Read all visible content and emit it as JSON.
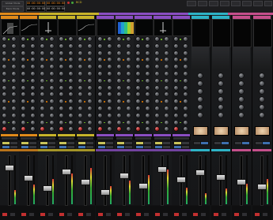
{
  "topbar": {
    "label_a": "Global Mode",
    "label_b": "Bank Mode",
    "timecode_primary": "00:00:00:00",
    "timecode_secondary": "00:00:00:00",
    "timecode_primary_b": "00:00:00:00",
    "timecode_secondary_b": "00:00:00:00",
    "mode_label": "BCD"
  },
  "colors": {
    "orange": "#e08a1a",
    "yellow": "#c8b42a",
    "purple": "#8a4ec2",
    "cyan": "#2eb3c6",
    "pink": "#c54f8b",
    "green": "#47a63a",
    "red": "#c23030",
    "fader_cap": "#d0d0d0"
  },
  "channels": [
    {
      "color": "#e08a1a",
      "display": "compressor"
    },
    {
      "color": "#e08a1a",
      "display": "eq-curve"
    },
    {
      "color": "#c8b42a",
      "display": "gate"
    },
    {
      "color": "#c8b42a",
      "display": "blank"
    },
    {
      "color": "#c8b42a",
      "display": "eq-curve"
    },
    {
      "color": "#8a4ec2",
      "display": "blank"
    },
    {
      "color": "#8a4ec2",
      "display": "spectrum"
    },
    {
      "color": "#8a4ec2",
      "display": "blank"
    },
    {
      "color": "#8a4ec2",
      "display": "gate"
    },
    {
      "color": "#8a4ec2",
      "display": "blank"
    }
  ],
  "fx_returns": [
    {
      "color": "#2eb3c6"
    },
    {
      "color": "#2eb3c6"
    },
    {
      "color": "#c54f8b"
    },
    {
      "color": "#c54f8b"
    }
  ],
  "icons": {
    "play": "play-icon",
    "stop": "stop-icon",
    "record": "record-icon"
  }
}
